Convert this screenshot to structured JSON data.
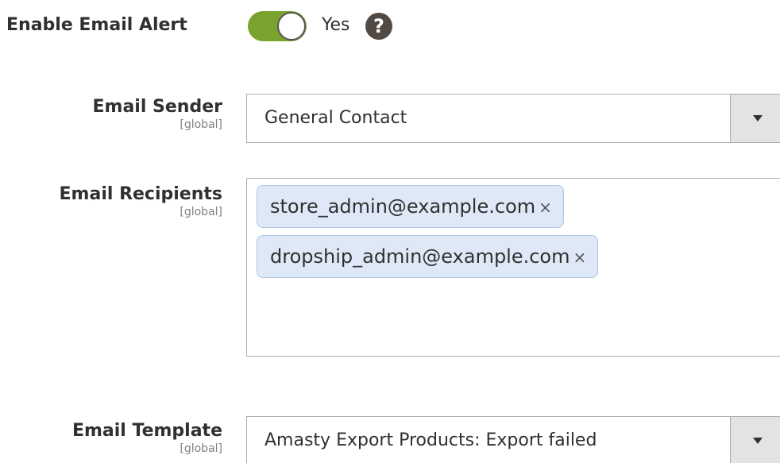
{
  "enable_email_alert": {
    "label": "Enable Email Alert",
    "toggle_on": true,
    "toggle_text": "Yes",
    "help_glyph": "?",
    "toggle_color": "#79a22e"
  },
  "email_sender": {
    "label": "Email Sender",
    "scope": "[global]",
    "value": "General Contact"
  },
  "email_recipients": {
    "label": "Email Recipients",
    "scope": "[global]",
    "tags": [
      {
        "text": "store_admin@example.com",
        "remove": "×"
      },
      {
        "text": "dropship_admin@example.com",
        "remove": "×"
      }
    ],
    "tag_color": "#dfe8f7"
  },
  "email_template": {
    "label": "Email Template",
    "scope": "[global]",
    "value": "Amasty Export Products: Export failed"
  }
}
